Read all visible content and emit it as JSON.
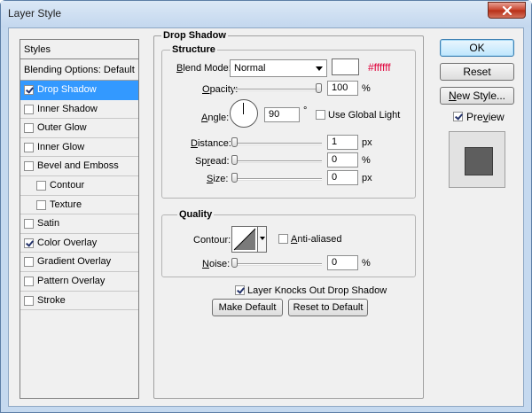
{
  "window": {
    "title": "Layer Style"
  },
  "styles": {
    "header": "Styles",
    "items": [
      {
        "label": "Blending Options: Default",
        "checkbox": false,
        "checked": false,
        "indent": 0,
        "active": false
      },
      {
        "label": "Drop Shadow",
        "checkbox": true,
        "checked": true,
        "indent": 0,
        "active": true
      },
      {
        "label": "Inner Shadow",
        "checkbox": true,
        "checked": false,
        "indent": 0,
        "active": false
      },
      {
        "label": "Outer Glow",
        "checkbox": true,
        "checked": false,
        "indent": 0,
        "active": false
      },
      {
        "label": "Inner Glow",
        "checkbox": true,
        "checked": false,
        "indent": 0,
        "active": false
      },
      {
        "label": "Bevel and Emboss",
        "checkbox": true,
        "checked": false,
        "indent": 0,
        "active": false
      },
      {
        "label": "Contour",
        "checkbox": true,
        "checked": false,
        "indent": 1,
        "active": false
      },
      {
        "label": "Texture",
        "checkbox": true,
        "checked": false,
        "indent": 1,
        "active": false
      },
      {
        "label": "Satin",
        "checkbox": true,
        "checked": false,
        "indent": 0,
        "active": false
      },
      {
        "label": "Color Overlay",
        "checkbox": true,
        "checked": true,
        "indent": 0,
        "active": false
      },
      {
        "label": "Gradient Overlay",
        "checkbox": true,
        "checked": false,
        "indent": 0,
        "active": false
      },
      {
        "label": "Pattern Overlay",
        "checkbox": true,
        "checked": false,
        "indent": 0,
        "active": false
      },
      {
        "label": "Stroke",
        "checkbox": true,
        "checked": false,
        "indent": 0,
        "active": false
      }
    ]
  },
  "drop_shadow": {
    "section_title": "Drop Shadow",
    "structure": {
      "title": "Structure",
      "blend_mode_label": "Blend Mode:",
      "blend_mode_value": "Normal",
      "color_hex": "#ffffff",
      "opacity_label": "Opacity:",
      "opacity_value": "100",
      "opacity_unit": "%",
      "angle_label": "Angle:",
      "angle_value": "90",
      "angle_unit": "°",
      "use_global_light_label": "Use Global Light",
      "use_global_light_checked": false,
      "distance_label": "Distance:",
      "distance_value": "1",
      "distance_unit": "px",
      "spread_label": "Spread:",
      "spread_value": "0",
      "spread_unit": "%",
      "size_label": "Size:",
      "size_value": "0",
      "size_unit": "px"
    },
    "quality": {
      "title": "Quality",
      "contour_label": "Contour:",
      "anti_aliased_label": "Anti-aliased",
      "anti_aliased_checked": false,
      "noise_label": "Noise:",
      "noise_value": "0",
      "noise_unit": "%"
    },
    "layer_knocks_out_label": "Layer Knocks Out Drop Shadow",
    "layer_knocks_out_checked": true,
    "make_default_label": "Make Default",
    "reset_default_label": "Reset to Default"
  },
  "actions": {
    "ok_label": "OK",
    "reset_label": "Reset",
    "new_style_label": "New Style...",
    "preview_label": "Preview",
    "preview_checked": true
  }
}
